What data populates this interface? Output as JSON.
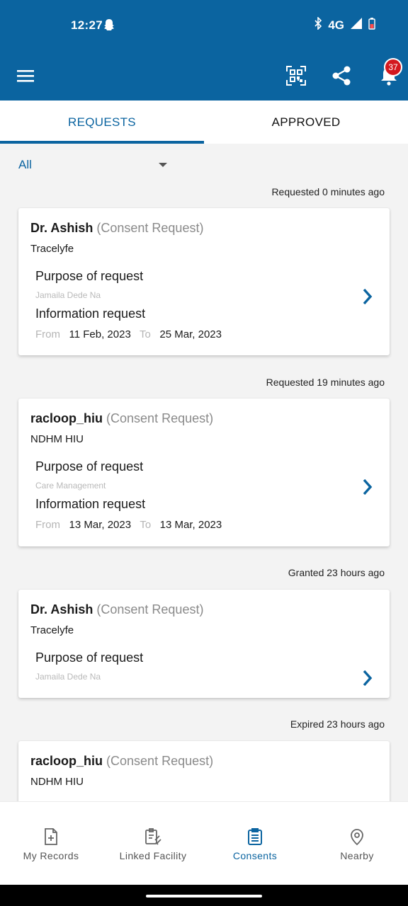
{
  "status_bar": {
    "time": "12:27",
    "network": "4G"
  },
  "app_bar": {
    "notification_count": "37",
    "accent": "#0b64a0"
  },
  "tabs": [
    {
      "label": "REQUESTS",
      "active": true
    },
    {
      "label": "APPROVED",
      "active": false
    }
  ],
  "filter": {
    "selected": "All"
  },
  "entries": [
    {
      "stamp": "Requested 0 minutes ago",
      "requester": "Dr. Ashish",
      "kind": "(Consent Request)",
      "org": "Tracelyfe",
      "purpose_label": "Purpose of request",
      "purpose": "Jamaila Dede Na",
      "info_label": "Information request",
      "from_label": "From",
      "from": "11 Feb, 2023",
      "to_label": "To",
      "to": "25 Mar, 2023"
    },
    {
      "stamp": "Requested 19 minutes ago",
      "requester": "racloop_hiu",
      "kind": "(Consent Request)",
      "org": "NDHM HIU",
      "purpose_label": "Purpose of request",
      "purpose": "Care Management",
      "info_label": "Information request",
      "from_label": "From",
      "from": "13 Mar, 2023",
      "to_label": "To",
      "to": "13 Mar, 2023"
    },
    {
      "stamp": "Granted 23 hours ago",
      "requester": "Dr. Ashish",
      "kind": "(Consent Request)",
      "org": "Tracelyfe",
      "purpose_label": "Purpose of request",
      "purpose": "Jamaila Dede Na"
    },
    {
      "stamp": "Expired 23 hours ago",
      "requester": "racloop_hiu",
      "kind": "(Consent Request)",
      "org": "NDHM HIU"
    }
  ],
  "bottom_nav": [
    {
      "label": "My Records",
      "icon": "records-icon",
      "active": false
    },
    {
      "label": "Linked Facility",
      "icon": "linked-facility-icon",
      "active": false
    },
    {
      "label": "Consents",
      "icon": "consents-icon",
      "active": true
    },
    {
      "label": "Nearby",
      "icon": "location-pin-icon",
      "active": false
    }
  ]
}
